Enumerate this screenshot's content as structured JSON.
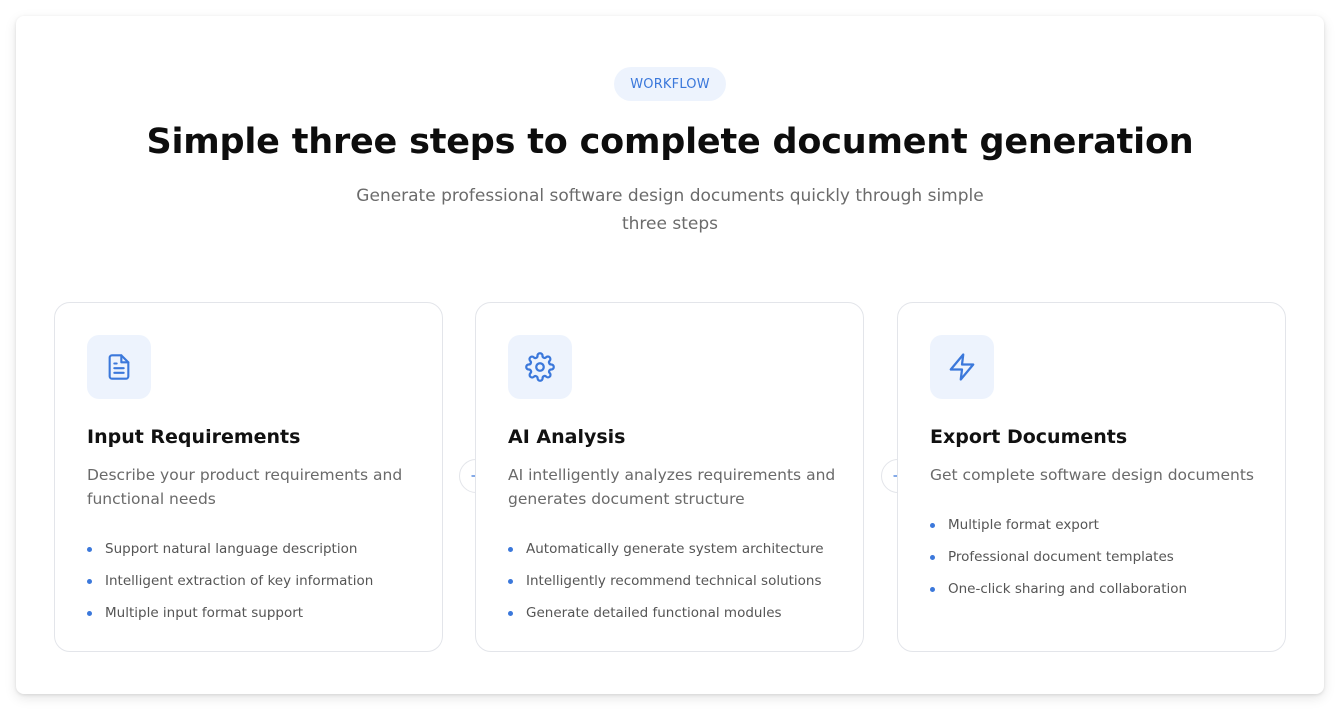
{
  "section": {
    "badge": "WORKFLOW",
    "title": "Simple three steps to complete document generation",
    "subtitle": "Generate professional software design documents quickly through simple three steps"
  },
  "steps": [
    {
      "icon": "document-icon",
      "title": "Input Requirements",
      "description": "Describe your product requirements and functional needs",
      "features": [
        "Support natural language description",
        "Intelligent extraction of key information",
        "Multiple input format support"
      ]
    },
    {
      "icon": "gear-icon",
      "title": "AI Analysis",
      "description": "AI intelligently analyzes requirements and generates document structure",
      "features": [
        "Automatically generate system architecture",
        "Intelligently recommend technical solutions",
        "Generate detailed functional modules"
      ]
    },
    {
      "icon": "lightning-icon",
      "title": "Export Documents",
      "description": "Get complete software design documents",
      "features": [
        "Multiple format export",
        "Professional document templates",
        "One-click sharing and collaboration"
      ]
    }
  ],
  "connectors": [
    "arrow-right-icon",
    "arrow-right-icon"
  ],
  "colors": {
    "accent": "#3b78db",
    "accent_bg": "#edf3fd",
    "border": "#e3e5ea",
    "title": "#0d0d0d",
    "muted": "#6a6a6a"
  }
}
